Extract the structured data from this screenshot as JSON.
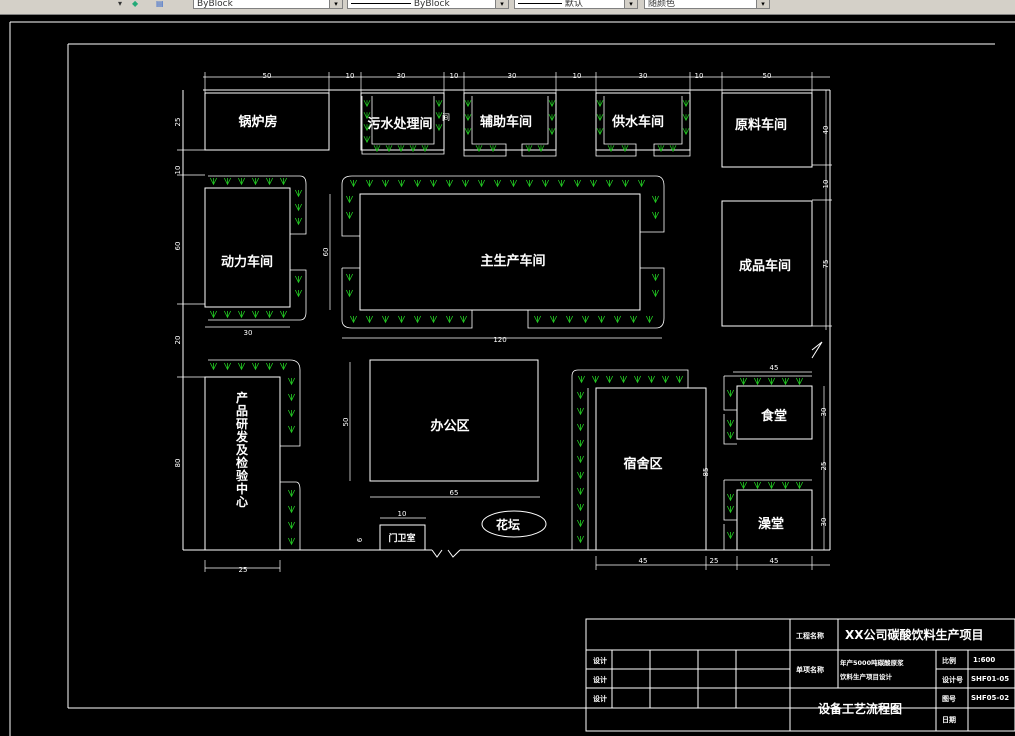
{
  "toolbar": {
    "layer_combo_arrow": "▾",
    "color_combo": "ByBlock",
    "linetype_combo": "ByBlock",
    "lineweight_combo": "默认",
    "plotstyle_combo": "随颜色"
  },
  "buildings": {
    "boiler": "锅炉房",
    "sewage": "污水处理间",
    "auxiliary": "辅助车间",
    "water": "供水车间",
    "raw": "原料车间",
    "power": "动力车间",
    "main": "主生产车间",
    "product": "成品车间",
    "rnd": "产品研发及检验中心",
    "office": "办公区",
    "dorm": "宿舍区",
    "canteen": "食堂",
    "bath": "澡堂",
    "flower": "花坛",
    "gate": "门卫室",
    "sewage_side": "间"
  },
  "dims": {
    "top_50a": "50",
    "top_10a": "10",
    "top_30a": "30",
    "top_10b": "10",
    "top_30b": "30",
    "top_10c": "10",
    "top_30c": "30",
    "top_10d": "10",
    "top_50b": "50",
    "left_25": "25",
    "left_10": "10",
    "left_60": "60",
    "left_20": "20",
    "left_80": "80",
    "right_40": "40",
    "right_10": "10",
    "right_75": "75",
    "power_30": "30",
    "main_60": "60",
    "main_120": "120",
    "office_50": "50",
    "office_65": "65",
    "gate_10": "10",
    "gate_6": "6",
    "rnd_25": "25",
    "dorm_45": "45",
    "dorm_25": "25",
    "dorm_85": "85",
    "canteen_45": "45",
    "canteen_30": "30",
    "canteen_25": "25",
    "bath_30": "30",
    "bath_45": "45"
  },
  "title_block": {
    "project_label": "工程名称",
    "project_name": "XX公司碳酸饮料生产项目",
    "design": "设计",
    "check": "设计",
    "review": "设计",
    "unit_label": "单项名称",
    "unit_name_1": "年产5000吨碳酸原浆",
    "unit_name_2": "饮料生产项目设计",
    "scale_label": "比例",
    "scale_value": "1:600",
    "design_no_label": "设计号",
    "design_no_value": "SHF01-05",
    "drawing_no_label": "图号",
    "drawing_no_value": "SHF05-02",
    "date_label": "日期",
    "drawing_title": "设备工艺流程图"
  },
  "colors": {
    "background": "#000000",
    "lines": "#ffffff",
    "trees": "#22cc22"
  }
}
